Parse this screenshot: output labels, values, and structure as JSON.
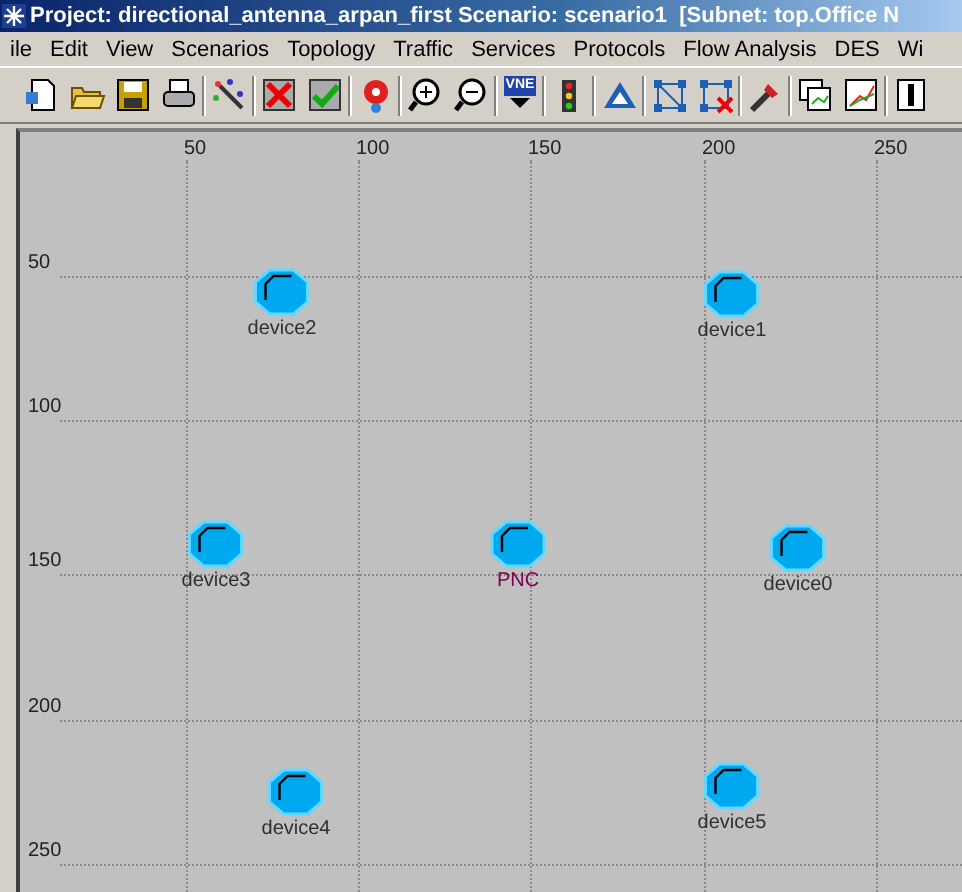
{
  "window": {
    "title": "Project: directional_antenna_arpan_first Scenario: scenario1  [Subnet: top.Office N"
  },
  "menu": [
    "ile",
    "Edit",
    "View",
    "Scenarios",
    "Topology",
    "Traffic",
    "Services",
    "Protocols",
    "Flow Analysis",
    "DES",
    "Wi"
  ],
  "toolbar": {
    "vne_label": "VNE"
  },
  "canvas": {
    "x_ruler": [
      "50",
      "100",
      "150",
      "200",
      "250"
    ],
    "y_ruler": [
      "50",
      "100",
      "150",
      "200",
      "250"
    ],
    "nodes": [
      {
        "label": "device2",
        "color": "#303030"
      },
      {
        "label": "device1",
        "color": "#303030"
      },
      {
        "label": "device3",
        "color": "#303030"
      },
      {
        "label": "PNC",
        "color": "#800050"
      },
      {
        "label": "device0",
        "color": "#303030"
      },
      {
        "label": "device4",
        "color": "#303030"
      },
      {
        "label": "device5",
        "color": "#303030"
      }
    ]
  }
}
